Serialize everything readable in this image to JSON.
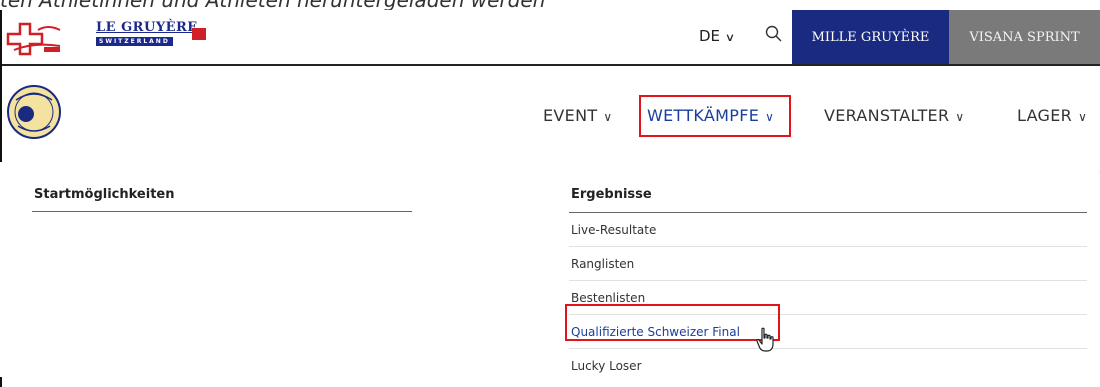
{
  "caption": "ten Athletinnen und Athleten heruntergeladen werden",
  "header": {
    "brand_main": "LE GRUYÈRE",
    "brand_sub": "SWITZERLAND",
    "language": "DE",
    "buttons": [
      "MILLE GRUYÈRE",
      "VISANA SPRINT"
    ]
  },
  "nav": {
    "items": [
      {
        "label": "EVENT"
      },
      {
        "label": "WETTKÄMPFE"
      },
      {
        "label": "VERANSTALTER"
      },
      {
        "label": "LAGER"
      }
    ]
  },
  "menu": {
    "left_heading": "Startmöglichkeiten",
    "right_heading": "Ergebnisse",
    "links": [
      "Live-Resultate",
      "Ranglisten",
      "Bestenlisten",
      "Qualifizierte Schweizer Final",
      "Lucky Loser"
    ]
  },
  "colors": {
    "brand_blue": "#1a2a80",
    "highlight_red": "#e0141b",
    "grey_button": "#7a7a7a"
  },
  "icons": [
    "search-icon",
    "chevron-down-icon",
    "hand-cursor-icon"
  ]
}
